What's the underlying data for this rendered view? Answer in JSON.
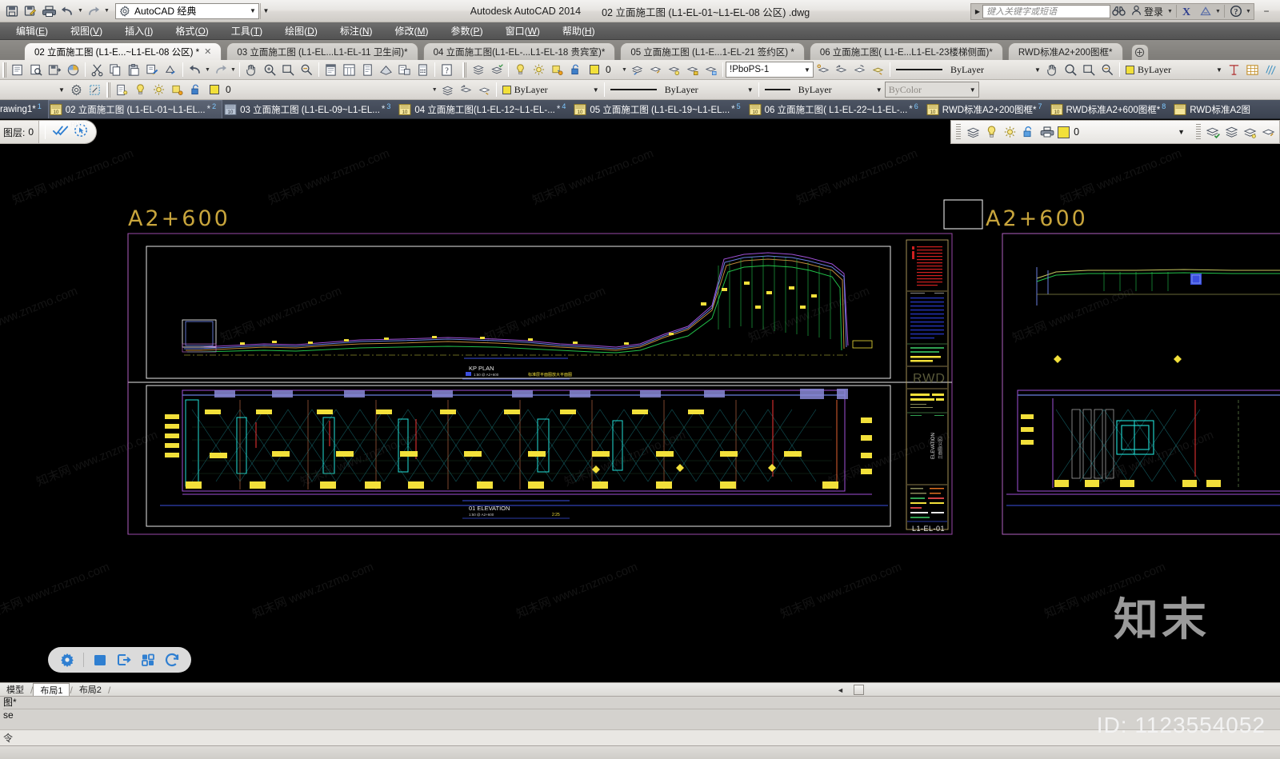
{
  "app": {
    "title_product": "Autodesk AutoCAD 2014",
    "title_file": "02 立面施工图 (L1-EL-01~L1-EL-08 公区) .dwg",
    "workspace": "AutoCAD 经典",
    "workspace_gear_icon": "gear-icon"
  },
  "quick_access": [
    {
      "name": "save-button",
      "icon": "save-icon"
    },
    {
      "name": "save-as-button",
      "icon": "save-as-icon"
    },
    {
      "name": "plot-button",
      "icon": "printer-icon"
    },
    {
      "name": "undo-button",
      "icon": "undo-arrow-icon"
    },
    {
      "name": "redo-button",
      "icon": "redo-arrow-icon"
    }
  ],
  "infocenter": {
    "placeholder": "键入关键字或短语",
    "search_icon": "binoculars-icon",
    "login_label": "登录",
    "user_icon": "person-icon",
    "exchange_icon": "exchange-x-icon",
    "autodesk_icon": "autodesk-a-icon",
    "help_icon": "help-question-icon"
  },
  "window_controls": {
    "minimize": "−"
  },
  "menu": [
    {
      "label": "编辑",
      "key": "E"
    },
    {
      "label": "视图",
      "key": "V"
    },
    {
      "label": "插入",
      "key": "I"
    },
    {
      "label": "格式",
      "key": "O"
    },
    {
      "label": "工具",
      "key": "T"
    },
    {
      "label": "绘图",
      "key": "D"
    },
    {
      "label": "标注",
      "key": "N"
    },
    {
      "label": "修改",
      "key": "M"
    },
    {
      "label": "参数",
      "key": "P"
    },
    {
      "label": "窗口",
      "key": "W"
    },
    {
      "label": "帮助",
      "key": "H"
    }
  ],
  "file_tabs": [
    {
      "label": "02 立面施工图 (L1-E...~L1-EL-08 公区) *",
      "active": true,
      "closable": true
    },
    {
      "label": "03 立面施工图 (L1-EL...L1-EL-11 卫生间)*",
      "active": false,
      "closable": false
    },
    {
      "label": "04 立面施工图(L1-EL-...L1-EL-18 贵宾室)*",
      "active": false,
      "closable": false
    },
    {
      "label": "05 立面施工图 (L1-E...1-EL-21 签约区) *",
      "active": false,
      "closable": false
    },
    {
      "label": "06 立面施工图( L1-E...L1-EL-23楼梯侧面)*",
      "active": false,
      "closable": false
    },
    {
      "label": "RWD标准A2+200图框*",
      "active": false,
      "closable": false
    }
  ],
  "toolbar_row1": {
    "layer_color_value": "0",
    "plot_style_value": "!PboPS-1",
    "linetype_value": "ByLayer",
    "lineweight_value": "ByLayer",
    "dim_style_value": "ByLayer",
    "dim_style_value2": "ByLayer"
  },
  "toolbar_row2": {
    "textstyle_value": "",
    "layer_value": "0",
    "color_value": "ByLayer",
    "linetype_value": "ByLayer",
    "lineweight_value": "ByLayer",
    "plotstyle_value": "ByColor"
  },
  "drawing_tabs": [
    {
      "label": "rawing1*",
      "num": "1",
      "icon": "dwg-icon",
      "current": false
    },
    {
      "label": "02 立面施工图 (L1-EL-01~L1-EL...",
      "num": "2",
      "icon": "dwg-icon",
      "current": true,
      "star": "*"
    },
    {
      "label": "03 立面施工图 (L1-EL-09~L1-EL...",
      "num": "3",
      "icon": "dwg-icon",
      "current": false,
      "star": "*"
    },
    {
      "label": "04 立面施工图(L1-EL-12~L1-EL-...",
      "num": "4",
      "icon": "dwg-icon",
      "current": false,
      "star": "*"
    },
    {
      "label": "05 立面施工图 (L1-EL-19~L1-EL...",
      "num": "5",
      "icon": "dwg-icon",
      "current": false,
      "star": "*"
    },
    {
      "label": "06 立面施工图( L1-EL-22~L1-EL-...",
      "num": "6",
      "icon": "dwg-icon",
      "current": false,
      "star": "*"
    },
    {
      "label": "RWD标准A2+200图框*",
      "num": "7",
      "icon": "dwg-icon",
      "current": false
    },
    {
      "label": "RWD标准A2+600图框*",
      "num": "8",
      "icon": "dwg-icon",
      "current": false
    },
    {
      "label": "RWD标准A2图",
      "num": "",
      "icon": "dwg-icon",
      "current": false
    }
  ],
  "layer_bar": {
    "left_label": "图层:",
    "left_value": "0",
    "check_icon": "double-check-icon",
    "select_icon": "select-cursor-icon",
    "rwd_note": "RWD",
    "layer_value": "0",
    "layer_icons": [
      "layers-icon",
      "lightbulb-icon",
      "sun-icon",
      "unlock-icon",
      "plot-icon"
    ],
    "right_icons": [
      "layer-state-check-icon",
      "layer-manager-icon",
      "layer-previous-icon",
      "layer-isolate-icon"
    ]
  },
  "canvas": {
    "label_left": "A2+600",
    "label_right": "A2+600",
    "plan_title": "KP PLAN",
    "plan_sub": "1:50 @ A2+600",
    "plan_note": "标准层平面图放大平面图",
    "elevation_title": "01 ELEVATION",
    "elevation_sub": "1:50 @ A2+600",
    "elevation_scale": "2:25",
    "sheet_no": "L1-EL-01",
    "title_block_brand": "RWD",
    "title_block_type": "ELEVATION"
  },
  "nav_pill": [
    {
      "name": "settings-gear-button",
      "icon": "gear-blue-icon"
    },
    {
      "name": "fullscreen-button",
      "icon": "filled-square-icon"
    },
    {
      "name": "export-button",
      "icon": "export-icon"
    },
    {
      "name": "layout-button",
      "icon": "layout-grid-icon"
    },
    {
      "name": "refresh-button",
      "icon": "refresh-circular-icon"
    }
  ],
  "layout_tabs": [
    {
      "label": "模型",
      "active": false
    },
    {
      "label": "布局1",
      "active": true
    },
    {
      "label": "布局2",
      "active": false
    }
  ],
  "command_line": {
    "line1": "图*",
    "line2": "se",
    "prompt": "令"
  },
  "watermarks": {
    "big": "知末",
    "id": "ID: 1123554052",
    "tile": "知末网 www.znzmo.com"
  },
  "colors": {
    "canvas_bg": "#000000",
    "cad_yellow": "#f2e03a",
    "cad_cyan": "#22e0d8",
    "cad_magenta": "#d24bd2",
    "cad_blue": "#3b4fe0",
    "cad_green": "#22c24a",
    "cad_red": "#e03030",
    "cad_white": "#e8e8e8",
    "accent_blue": "#2f7fd1",
    "tab_blue_text": "#7ec8ff"
  }
}
